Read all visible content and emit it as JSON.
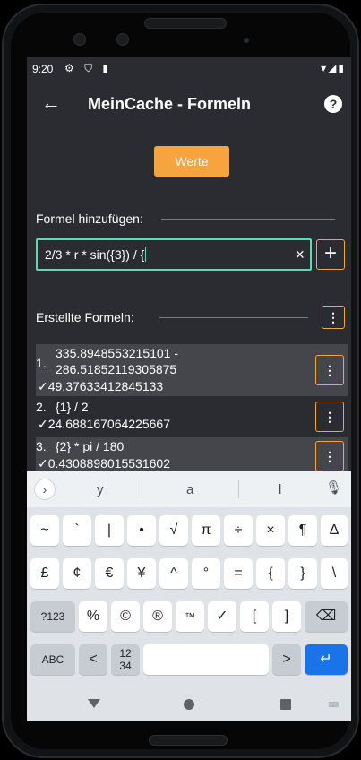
{
  "status": {
    "time": "9:20",
    "icons": "⚙ ⛉ ▮",
    "right_icons": "▾◢▮"
  },
  "appbar": {
    "title": "MeinCache - Formeln",
    "back": "←",
    "help": "?"
  },
  "werte_button": "Werte",
  "add_section": {
    "label": "Formel hinzufügen:"
  },
  "formula_input": {
    "value": "2/3 * r * sin({3}) / {",
    "clear": "×"
  },
  "add_button": "+",
  "created_section": {
    "label": "Erstellte Formeln:",
    "menu": "⋮"
  },
  "formulas": [
    {
      "num": "1.",
      "line1": "335.8948553215101 -",
      "line2": "286.51852119305875",
      "result": "✓49.37633412845133",
      "menu": "⋮"
    },
    {
      "num": "2.",
      "line1": "{1} / 2",
      "result": "✓24.688167064225667",
      "menu": "⋮"
    },
    {
      "num": "3.",
      "line1": "{2} * pi / 180",
      "result": "✓0.4308898015531602",
      "menu": "⋮"
    }
  ],
  "keyboard": {
    "suggestions": [
      "y",
      "a",
      "l"
    ],
    "suggest_arrow": "›",
    "mic": "🎙",
    "row1": [
      "~",
      "`",
      "|",
      "•",
      "√",
      "π",
      "÷",
      "×",
      "¶",
      "∆"
    ],
    "row2": [
      "£",
      "¢",
      "€",
      "¥",
      "^",
      "°",
      "=",
      "{",
      "}",
      "\\"
    ],
    "row3": [
      "?123",
      "%",
      "©",
      "®",
      "™",
      "✓",
      "[",
      "]",
      "⌫"
    ],
    "row4": [
      "ABC",
      "<",
      "12\n34",
      "",
      ">",
      "↵"
    ]
  },
  "nav": {
    "kbd": "⌨"
  }
}
